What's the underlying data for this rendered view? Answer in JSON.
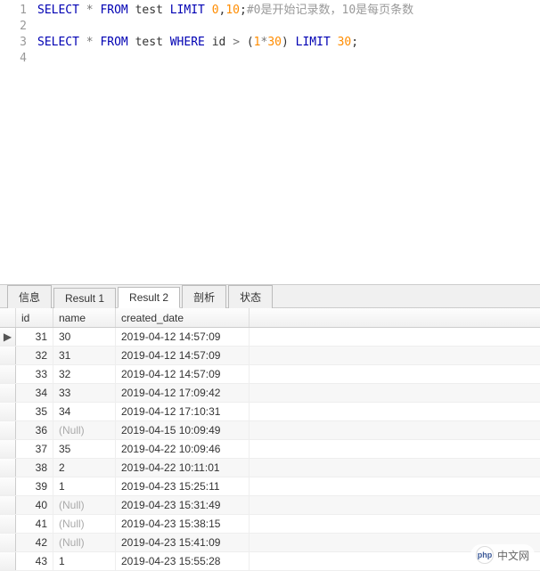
{
  "editor": {
    "lines": [
      "1",
      "2",
      "3",
      "4"
    ],
    "line1": {
      "t1": "SELECT",
      "t2": " * ",
      "t3": "FROM",
      "t4": " test ",
      "t5": "LIMIT",
      "t6": " ",
      "t7": "0",
      "t8": ",",
      "t9": "10",
      "t10": ";",
      "t11": "#0是开始记录数，10是每页条数"
    },
    "line3": {
      "t1": "SELECT",
      "t2": " * ",
      "t3": "FROM",
      "t4": " test ",
      "t5": "WHERE",
      "t6": " id ",
      "t7": ">",
      "t8": " (",
      "t9": "1",
      "t10": "*",
      "t11": "30",
      "t12": ") ",
      "t13": "LIMIT",
      "t14": " ",
      "t15": "30",
      "t16": ";"
    }
  },
  "tabs": {
    "t0": "信息",
    "t1": "Result 1",
    "t2": "Result 2",
    "t3": "剖析",
    "t4": "状态"
  },
  "columns": {
    "id": "id",
    "name": "name",
    "created_date": "created_date"
  },
  "rows": [
    {
      "indicator": "▶",
      "id": "31",
      "name": "30",
      "created_date": "2019-04-12 14:57:09"
    },
    {
      "indicator": "",
      "id": "32",
      "name": "31",
      "created_date": "2019-04-12 14:57:09"
    },
    {
      "indicator": "",
      "id": "33",
      "name": "32",
      "created_date": "2019-04-12 14:57:09"
    },
    {
      "indicator": "",
      "id": "34",
      "name": "33",
      "created_date": "2019-04-12 17:09:42"
    },
    {
      "indicator": "",
      "id": "35",
      "name": "34",
      "created_date": "2019-04-12 17:10:31"
    },
    {
      "indicator": "",
      "id": "36",
      "name": "(Null)",
      "created_date": "2019-04-15 10:09:49"
    },
    {
      "indicator": "",
      "id": "37",
      "name": "35",
      "created_date": "2019-04-22 10:09:46"
    },
    {
      "indicator": "",
      "id": "38",
      "name": "2",
      "created_date": "2019-04-22 10:11:01"
    },
    {
      "indicator": "",
      "id": "39",
      "name": "1",
      "created_date": "2019-04-23 15:25:11"
    },
    {
      "indicator": "",
      "id": "40",
      "name": "(Null)",
      "created_date": "2019-04-23 15:31:49"
    },
    {
      "indicator": "",
      "id": "41",
      "name": "(Null)",
      "created_date": "2019-04-23 15:38:15"
    },
    {
      "indicator": "",
      "id": "42",
      "name": "(Null)",
      "created_date": "2019-04-23 15:41:09"
    },
    {
      "indicator": "",
      "id": "43",
      "name": "1",
      "created_date": "2019-04-23 15:55:28"
    }
  ],
  "watermark": {
    "logo": "php",
    "text": "中文网"
  }
}
